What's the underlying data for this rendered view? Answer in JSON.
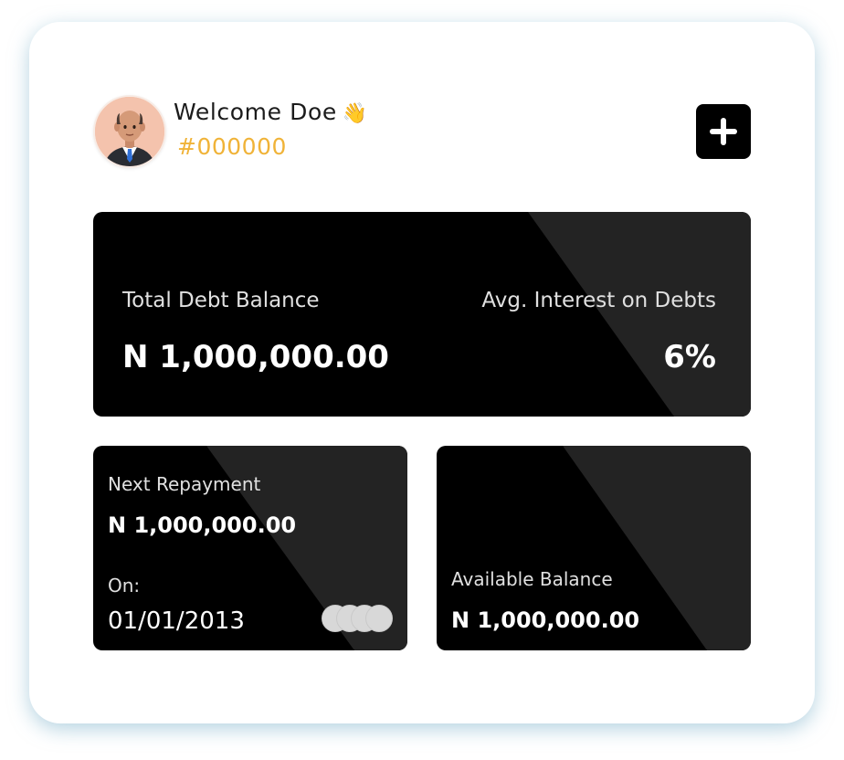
{
  "header": {
    "welcome_label": "Welcome Doe",
    "wave_emoji": "👋",
    "account_id": "#000000",
    "add_icon": "plus-icon"
  },
  "summary_card": {
    "total_debt_label": "Total Debt Balance",
    "total_debt_value": "N 1,000,000.00",
    "avg_interest_label": "Avg. Interest on Debts",
    "avg_interest_value": "6%"
  },
  "repayment_card": {
    "title": "Next Repayment",
    "amount": "N 1,000,000.00",
    "on_label": "On:",
    "date": "01/01/2013"
  },
  "balance_card": {
    "title": "Available Balance",
    "amount": "N 1,000,000.00"
  },
  "colors": {
    "card_bg": "#000000",
    "card_stripe": "#232323",
    "accent": "#F0B338",
    "frame_shadow": "#78AFC8"
  }
}
